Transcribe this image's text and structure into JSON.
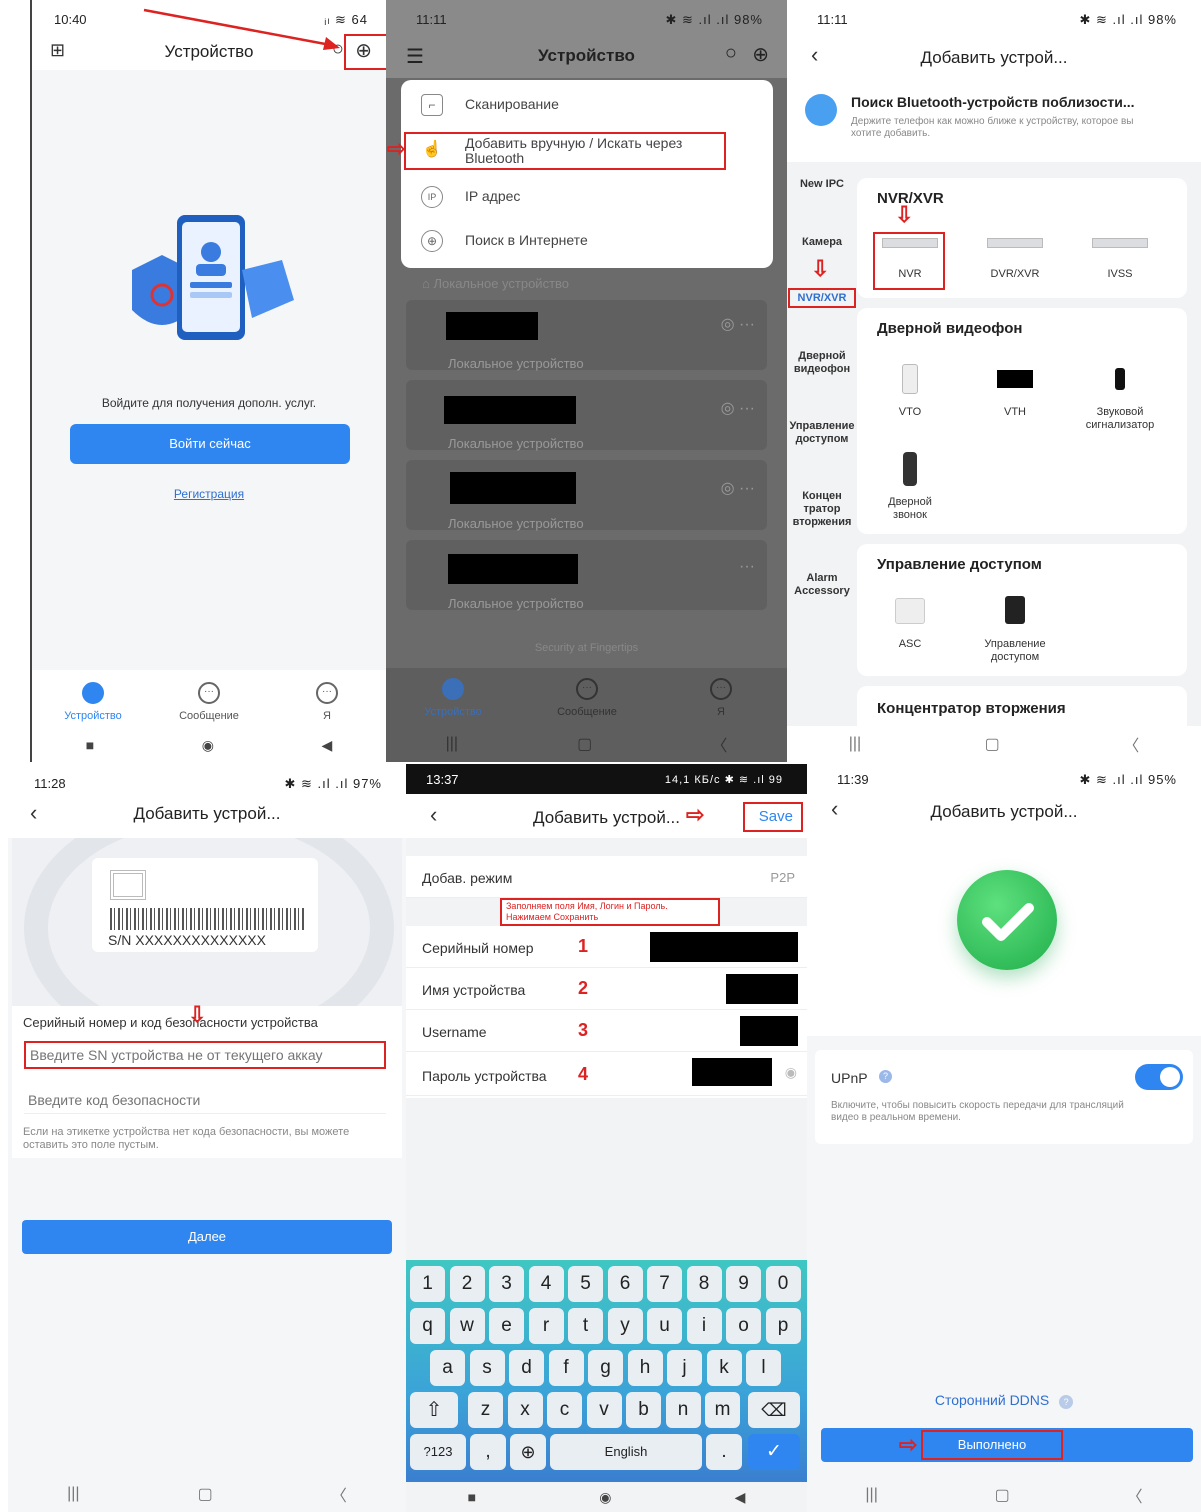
{
  "p1": {
    "status_time": "10:40",
    "status_icons": "ᵢₗ ≋ 64",
    "title": "Устройство",
    "login_prompt": "Войдите для получения дополн. услуг.",
    "login_button": "Войти сейчас",
    "register_link": "Регистрация",
    "tabs": [
      "Устройство",
      "Сообщение",
      "Я"
    ]
  },
  "p2": {
    "status_time": "11:11",
    "status_icons": "✱ ≋ .ıl .ıl 98%",
    "title": "Устройство",
    "menu": [
      {
        "icon": "scan-icon",
        "label": "Сканирование"
      },
      {
        "icon": "touch-icon",
        "label": "Добавить вручную / Искать через Bluetooth"
      },
      {
        "icon": "ip-icon",
        "label": "IP адрес"
      },
      {
        "icon": "globe-icon",
        "label": "Поиск в Интернете"
      }
    ],
    "device_label": "Локальное устройство",
    "footer": "Security at Fingertips",
    "tabs": [
      "Устройство",
      "Сообщение",
      "Я"
    ]
  },
  "p3": {
    "status_time": "11:11",
    "status_icons": "✱ ≋ .ıl .ıl 98%",
    "title": "Добавить устрой...",
    "bt_title": "Поиск Bluetooth-устройств поблизости...",
    "bt_sub": "Держите телефон как можно ближе к устройству, которое вы хотите добавить.",
    "categories": [
      "New IPC",
      "Камера",
      "NVR/XVR",
      "Дверной видеофон",
      "Управление доступом",
      "Концен тратор вторжения",
      "Alarm Accessory"
    ],
    "sections": [
      {
        "title": "NVR/XVR",
        "items": [
          "NVR",
          "DVR/XVR",
          "IVSS"
        ]
      },
      {
        "title": "Дверной видеофон",
        "items": [
          "VTO",
          "VTH",
          "Звуковой сигнализатор",
          "Дверной звонок"
        ]
      },
      {
        "title": "Управление доступом",
        "items": [
          "ASC",
          "Управление доступом"
        ]
      },
      {
        "title": "Концентратор вторжения",
        "items": []
      }
    ]
  },
  "p4": {
    "status_time": "11:28",
    "status_icons": "✱ ≋ .ıl .ıl 97%",
    "title": "Добавить устрой...",
    "sn_label": "S/N  XXXXXXXXXXXXXX",
    "field_heading": "Серийный номер и код безопасности устройства",
    "sn_placeholder": "Введите SN устройства не от текущего аккау",
    "code_placeholder": "Введите код безопасности",
    "hint": "Если на этикетке устройства нет кода безопасности, вы можете оставить это поле пустым.",
    "next_button": "Далее"
  },
  "p5": {
    "status_time": "13:37",
    "status_icons": "14,1 КБ/с ✱ ≋ .ıl 99",
    "title": "Добавить устрой...",
    "save": "Save",
    "mode_label": "Добав. режим",
    "mode_value": "P2P",
    "note": "Заполняем поля Имя, Логин и Пароль. Нажимаем Сохранить",
    "fields": [
      {
        "label": "Серийный номер",
        "num": "1"
      },
      {
        "label": "Имя устройства",
        "num": "2"
      },
      {
        "label": "Username",
        "num": "3"
      },
      {
        "label": "Пароль устройства",
        "num": "4"
      }
    ],
    "keys_row1": [
      "1",
      "2",
      "3",
      "4",
      "5",
      "6",
      "7",
      "8",
      "9",
      "0"
    ],
    "keys_row2": [
      "q",
      "w",
      "e",
      "r",
      "t",
      "y",
      "u",
      "i",
      "o",
      "p"
    ],
    "keys_row3": [
      "a",
      "s",
      "d",
      "f",
      "g",
      "h",
      "j",
      "k",
      "l"
    ],
    "keys_row4": [
      "z",
      "x",
      "c",
      "v",
      "b",
      "n",
      "m"
    ],
    "key_symbols": "?123",
    "key_comma": ",",
    "key_space": "English",
    "key_dot": "."
  },
  "p6": {
    "status_time": "11:39",
    "status_icons": "✱ ≋ .ıl .ıl 95%",
    "title": "Добавить устрой...",
    "upnp_label": "UPnP",
    "upnp_desc": "Включите, чтобы повысить скорость передачи для трансляций видео в реальном времени.",
    "ddns_link": "Сторонний DDNS",
    "done_button": "Выполнено"
  },
  "colors": {
    "accent": "#2f86f0",
    "annotation": "#dd2222",
    "success": "#22bb55"
  }
}
